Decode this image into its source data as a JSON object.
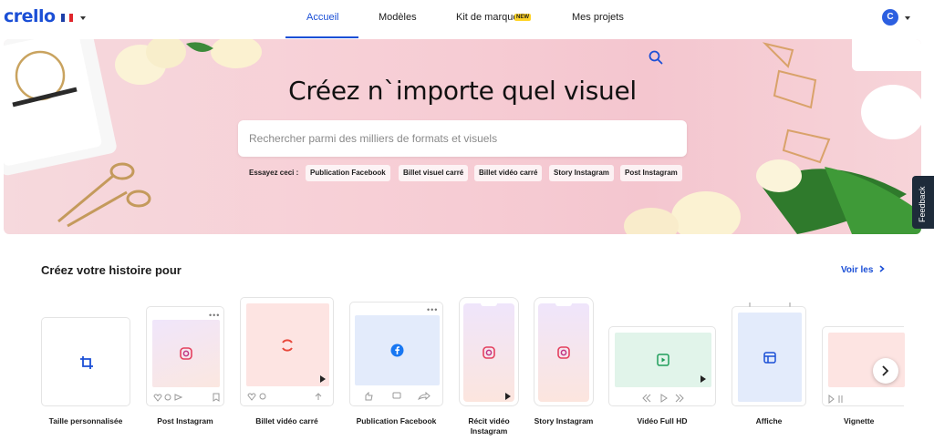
{
  "header": {
    "logo": "crello",
    "language_flag": "flag-fr-icon",
    "nav": [
      {
        "label": "Accueil",
        "active": true
      },
      {
        "label": "Modèles",
        "active": false
      },
      {
        "label": "Kit de marque",
        "active": false,
        "badge": "NEW"
      },
      {
        "label": "Mes projets",
        "active": false
      }
    ],
    "avatar_initial": "C"
  },
  "hero": {
    "title": "Créez n`importe quel visuel",
    "search_placeholder": "Rechercher parmi des milliers de formats et visuels",
    "search_value": "",
    "try_label": "Essayez ceci :",
    "suggestions": [
      "Publication Facebook",
      "Billet visuel carré",
      "Billet vidéo carré",
      "Story Instagram",
      "Post Instagram"
    ]
  },
  "feedback_label": "Feedback",
  "section": {
    "title": "Créez votre histoire pour",
    "see_all": "Voir les"
  },
  "formats": [
    {
      "label": "Taille personnalisée",
      "icon": "crop-icon"
    },
    {
      "label": "Post Instagram",
      "icon": "instagram-icon"
    },
    {
      "label": "Billet vidéo carré",
      "icon": "video-loop-icon"
    },
    {
      "label": "Publication Facebook",
      "icon": "facebook-icon"
    },
    {
      "label": "Récit vidéo Instagram",
      "icon": "instagram-icon"
    },
    {
      "label": "Story Instagram",
      "icon": "instagram-icon"
    },
    {
      "label": "Vidéo Full HD",
      "icon": "play-icon"
    },
    {
      "label": "Affiche",
      "icon": "poster-icon"
    },
    {
      "label": "Vignette",
      "icon": "thumbnail-icon"
    }
  ],
  "colors": {
    "brand": "#1b4fd6",
    "hero_bg": "#f7cfd6",
    "badge": "#ffd42a"
  }
}
